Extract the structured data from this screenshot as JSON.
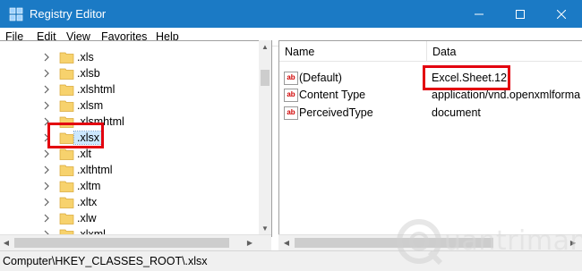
{
  "window": {
    "title": "Registry Editor",
    "controls": [
      "minimize",
      "maximize",
      "close"
    ]
  },
  "menu": [
    {
      "label": "File",
      "underline": "F",
      "rest": "ile"
    },
    {
      "label": "Edit",
      "underline": "E",
      "rest": "dit"
    },
    {
      "label": "View",
      "underline": "V",
      "rest": "iew"
    },
    {
      "label": "Favorites",
      "underline": "F",
      "rest": "avorites",
      "pre": "F",
      "full": "Favorites"
    },
    {
      "label": "Help",
      "underline": "H",
      "rest": "elp"
    }
  ],
  "tree": {
    "items": [
      {
        "label": ".xls"
      },
      {
        "label": ".xlsb"
      },
      {
        "label": ".xlshtml"
      },
      {
        "label": ".xlsm"
      },
      {
        "label": ".xlsmhtml"
      },
      {
        "label": ".xlsx",
        "selected": true
      },
      {
        "label": ".xlt"
      },
      {
        "label": ".xlthtml"
      },
      {
        "label": ".xltm"
      },
      {
        "label": ".xltx"
      },
      {
        "label": ".xlw"
      },
      {
        "label": ".xlxml"
      }
    ]
  },
  "values_list": {
    "columns": [
      "Name",
      "Data"
    ],
    "rows": [
      {
        "name": "(Default)",
        "data": "Excel.Sheet.12",
        "icon": "string-value-icon"
      },
      {
        "name": "Content Type",
        "data": "application/vnd.openxmlforma",
        "icon": "string-value-icon"
      },
      {
        "name": "PerceivedType",
        "data": "document",
        "icon": "string-value-icon"
      }
    ]
  },
  "status": {
    "path": "Computer\\HKEY_CLASSES_ROOT\\.xlsx"
  },
  "watermark": {
    "text": "uantrimang"
  },
  "colors": {
    "titlebar": "#1b7ac5",
    "highlight": "#e3000f",
    "selection": "#cce8ff",
    "folder": "#f7d26d"
  }
}
